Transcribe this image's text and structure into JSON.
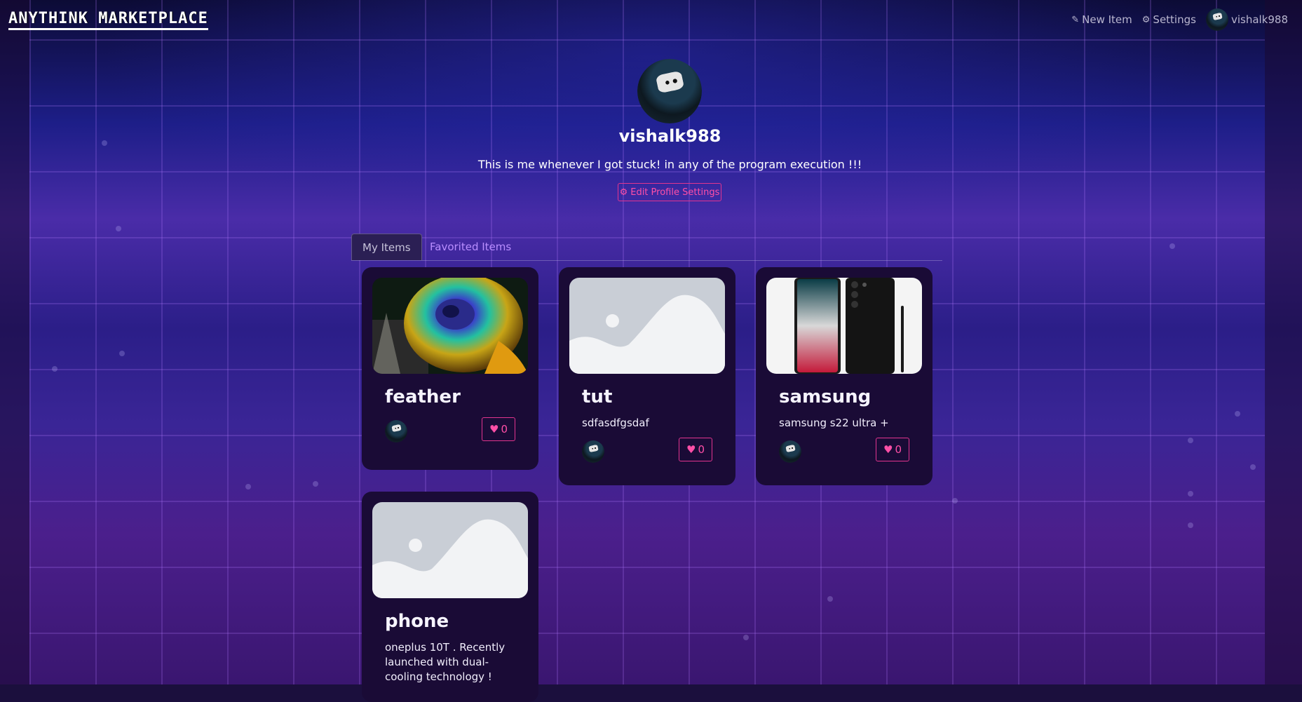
{
  "header": {
    "brand": "ANYTHINK MARKETPLACE",
    "nav": {
      "new_item": "New Item",
      "settings": "Settings",
      "username": "vishalk988"
    }
  },
  "profile": {
    "username": "vishalk988",
    "bio": "This is me whenever I got stuck! in any of the program execution !!!",
    "edit_button": "Edit Profile Settings"
  },
  "tabs": {
    "my_items": "My Items",
    "favorited_items": "Favorited Items"
  },
  "items": [
    {
      "title": "feather",
      "description": "",
      "favorites": "0",
      "image": "peacock-feather"
    },
    {
      "title": "tut",
      "description": "sdfasdfgsdaf",
      "favorites": "0",
      "image": "placeholder"
    },
    {
      "title": "samsung",
      "description": "samsung s22 ultra +",
      "favorites": "0",
      "image": "samsung-phone"
    },
    {
      "title": "phone",
      "description": "oneplus 10T . Recently launched with dual-cooling technology !",
      "favorites": "",
      "image": "placeholder"
    }
  ],
  "colors": {
    "accent": "#ff4fa7",
    "tab_link": "#b98dff",
    "card_bg": "#1a0b36"
  }
}
